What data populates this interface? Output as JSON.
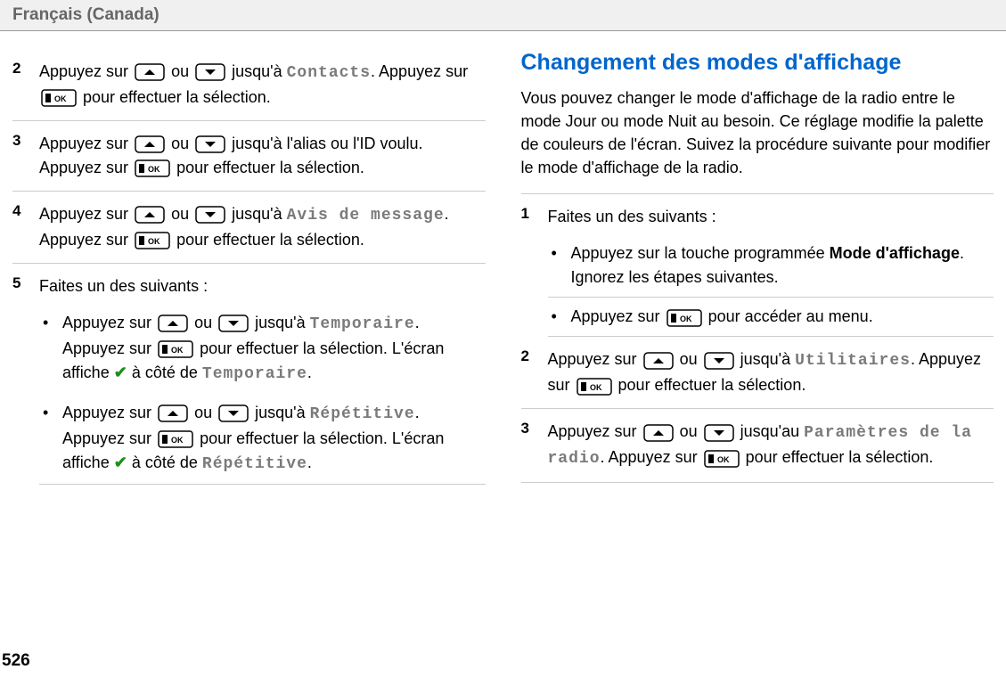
{
  "header": "Français (Canada)",
  "page_number": "526",
  "left": {
    "step2": {
      "num": "2",
      "text_a": "Appuyez sur ",
      "text_b": " ou ",
      "text_c": " jusqu'à ",
      "mono": "Contacts",
      "text_d": ". Appuyez sur ",
      "text_e": " pour effectuer la sélection."
    },
    "step3": {
      "num": "3",
      "text_a": "Appuyez sur ",
      "text_b": " ou ",
      "text_c": " jusqu'à l'alias ou l'ID voulu. Appuyez sur ",
      "text_d": " pour effectuer la sélection."
    },
    "step4": {
      "num": "4",
      "text_a": "Appuyez sur ",
      "text_b": " ou ",
      "text_c": " jusqu'à ",
      "mono": "Avis de message",
      "text_d": ". Appuyez sur ",
      "text_e": " pour effectuer la sélection."
    },
    "step5": {
      "num": "5",
      "intro": "Faites un des suivants :",
      "bullet1": {
        "text_a": "Appuyez sur ",
        "text_b": " ou ",
        "text_c": " jusqu'à ",
        "mono1": "Temporaire",
        "text_d": ". Appuyez sur ",
        "text_e": " pour effectuer la sélection. L'écran affiche ",
        "text_f": " à côté de ",
        "mono2": "Temporaire",
        "text_g": "."
      },
      "bullet2": {
        "text_a": "Appuyez sur ",
        "text_b": " ou ",
        "text_c": " jusqu'à ",
        "mono1": "Répétitive",
        "text_d": ". Appuyez sur ",
        "text_e": " pour effectuer la sélection. L'écran affiche ",
        "text_f": " à côté de ",
        "mono2": "Répétitive",
        "text_g": "."
      }
    }
  },
  "right": {
    "title": "Changement des modes d'affichage",
    "intro": "Vous pouvez changer le mode d'affichage de la radio entre le mode Jour ou mode Nuit au besoin. Ce réglage modifie la palette de couleurs de l'écran. Suivez la procédure suivante pour modifier le mode d'affichage de la radio.",
    "step1": {
      "num": "1",
      "intro": "Faites un des suivants :",
      "bullet1_a": "Appuyez sur la touche programmée ",
      "bullet1_bold": "Mode d'affichage",
      "bullet1_b": ". Ignorez les étapes suivantes.",
      "bullet2_a": "Appuyez sur ",
      "bullet2_b": " pour accéder au menu."
    },
    "step2": {
      "num": "2",
      "text_a": "Appuyez sur ",
      "text_b": " ou ",
      "text_c": " jusqu'à ",
      "mono": "Utilitaires",
      "text_d": ". Appuyez sur ",
      "text_e": " pour effectuer la sélection."
    },
    "step3": {
      "num": "3",
      "text_a": "Appuyez sur ",
      "text_b": " ou ",
      "text_c": " jusqu'au ",
      "mono": "Paramètres de la radio",
      "text_d": ". Appuyez sur ",
      "text_e": " pour effectuer la sélection."
    }
  }
}
